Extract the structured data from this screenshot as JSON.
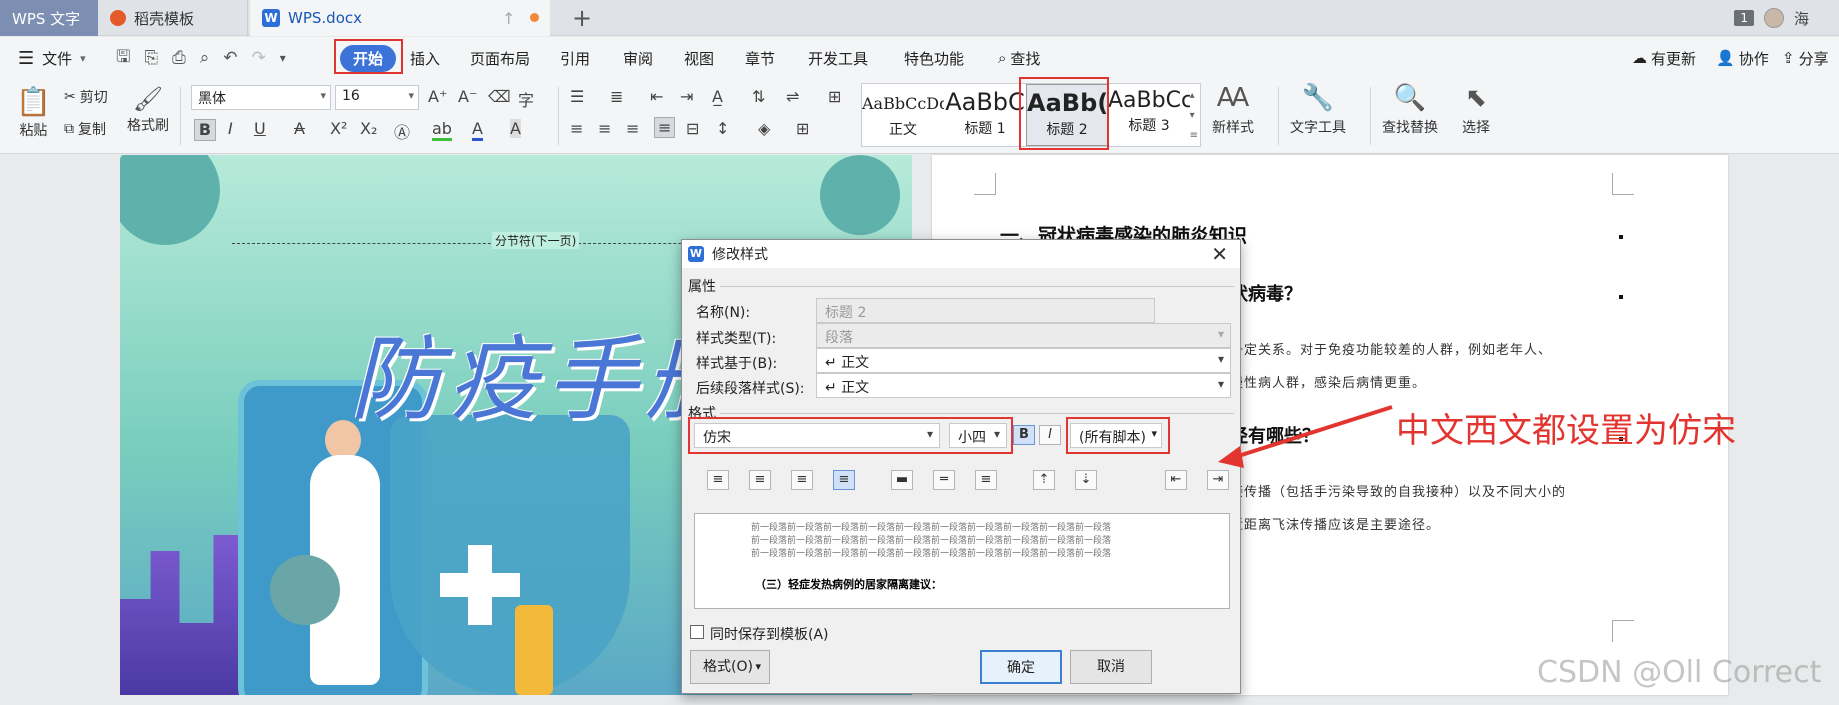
{
  "titlebar": {
    "app_tab": "WPS 文字",
    "tabs": [
      {
        "label": "稻壳模板"
      },
      {
        "label": "WPS.docx"
      }
    ],
    "new_tab": "+",
    "count": "1",
    "user": "海"
  },
  "menubar": {
    "file": "文件",
    "items": [
      "开始",
      "插入",
      "页面布局",
      "引用",
      "审阅",
      "视图",
      "章节",
      "开发工具",
      "特色功能",
      "查找"
    ],
    "right": [
      "有更新",
      "协作",
      "分享"
    ]
  },
  "ribbon": {
    "paste": "粘贴",
    "cut": "剪切",
    "copy": "复制",
    "format_painter": "格式刷",
    "font_name": "黑体",
    "font_size": "16",
    "styles": [
      {
        "sample": "AaBbCcDd",
        "name": "正文"
      },
      {
        "sample": "AaBbC",
        "name": "标题 1"
      },
      {
        "sample": "AaBb(",
        "name": "标题 2"
      },
      {
        "sample": "AaBbCc",
        "name": "标题 3"
      }
    ],
    "new_style": "新样式",
    "text_tools": "文字工具",
    "find_replace": "查找替换",
    "select": "选择"
  },
  "document": {
    "cover_divider": "分节符(下一页)",
    "cover_title": "防疫手册",
    "heading1": "一、冠状病毒感染的肺炎知识",
    "heading2_tail": "状病毒？",
    "para1_line1": "一定关系。对于免疫功能较差的人群，例如老年人、",
    "para1_line2": "慢性病人群，感染后病情更重。",
    "heading3_tail": "径有哪些？",
    "para2_line1": "接传播（包括手污染导致的自我接种）以及不同大小的",
    "para2_line2": "近距离飞沫传播应该是主要途径。"
  },
  "dialog": {
    "title": "修改样式",
    "section_properties": "属性",
    "name_label": "名称(N):",
    "name_value": "标题 2",
    "type_label": "样式类型(T):",
    "type_value": "段落",
    "based_label": "样式基于(B):",
    "based_value": "↵ 正文",
    "next_label": "后续段落样式(S):",
    "next_value": "↵ 正文",
    "section_format": "格式",
    "font_value": "仿宋",
    "size_value": "小四",
    "bold": "B",
    "italic": "I",
    "script_value": "(所有脚本)",
    "preview_line": "前一段落前一段落前一段落前一段落前一段落前一段落前一段落前一段落前一段落前一段落",
    "preview_line_last": "前一段落前一段落前一段落前一段落前一段落前一段落前一段落前一段落前一段落前一段落",
    "preview_sample": "（三）轻症发热病例的居家隔离建议：",
    "save_template": "同时保存到模板(A)",
    "format_btn": "格式(O)",
    "ok": "确定",
    "cancel": "取消"
  },
  "annotation": {
    "text": "中文西文都设置为仿宋",
    "color": "#e3352f"
  },
  "watermark": "CSDN @Oll Correct"
}
